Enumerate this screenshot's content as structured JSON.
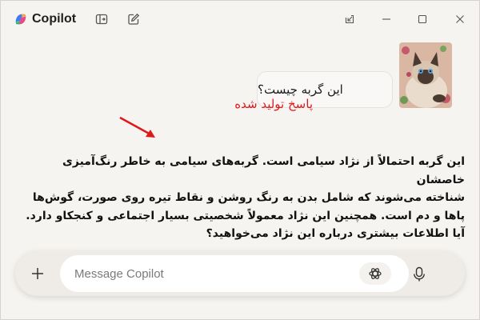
{
  "app": {
    "title": "Copilot",
    "brand_colors": [
      "#3f7bf5",
      "#e74a8c",
      "#f7a733",
      "#34b56c"
    ]
  },
  "titlebar": {
    "icons": [
      "copilot-logo-icon",
      "sidebar-toggle-icon",
      "new-chat-icon",
      "pop-out-icon",
      "minimize-icon",
      "maximize-icon",
      "close-icon"
    ]
  },
  "chat": {
    "user_message": "این گربه چیست؟",
    "annotation": "پاسخ تولید شده",
    "annotation_color": "#e01818",
    "response_lines": [
      "این گربه احتمالاً از نژاد سیامی است. گربه‌های سیامی به خاطر رنگ‌آمیزی خاصشان",
      "شناخته می‌شوند که شامل بدن به رنگ روشن و نقاط تیره روی صورت، گوش‌ها",
      "پاها و دم است. همچنین این نژاد معمولاً شخصیتی بسیار اجتماعی و کنجکاو دارد.",
      "آیا اطلاعات بیشتری درباره این نژاد می‌خواهید؟"
    ]
  },
  "composer": {
    "placeholder": "Message Copilot",
    "value": "",
    "icons": [
      "plus-icon",
      "think-deeper-icon",
      "microphone-icon"
    ]
  }
}
